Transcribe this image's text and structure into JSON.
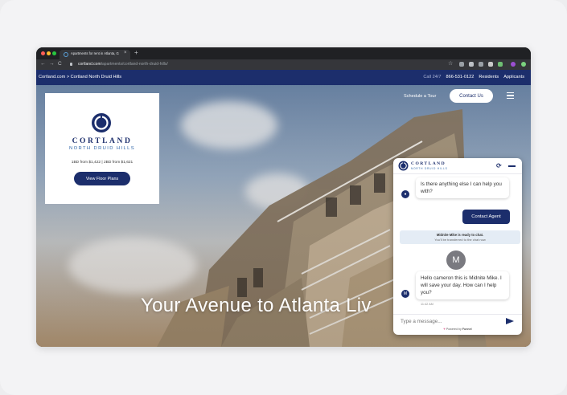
{
  "browser": {
    "tab_title": "Apartments for rent in Atlanta, G",
    "tab_close": "×",
    "new_tab": "+",
    "url_domain": "cortland.com",
    "url_path": "/apartments/cortland-north-druid-hills/",
    "back": "←",
    "forward": "→",
    "reload": "C"
  },
  "site_nav": {
    "breadcrumb": "Cortland.com  >  Cortland North Druid Hills",
    "call_label": "Call 24/7",
    "phone": "866-531-0122",
    "residents": "Residents",
    "applicants": "Applicants"
  },
  "hero": {
    "schedule_tour": "Schedule a Tour",
    "contact_us": "Contact Us",
    "tagline": "Your Avenue to Atlanta Liv"
  },
  "brand_card": {
    "name": "CORTLAND",
    "subname": "NORTH DRUID HILLS",
    "prices": "1BD from $1,422 | 2BD from $1,621",
    "cta": "View Floor Plans"
  },
  "chat": {
    "brand_name": "CORTLAND",
    "brand_sub": "NORTH DRUID HILLS",
    "bot_msg1": "Is there anything else I can help you with?",
    "contact_agent": "Contact Agent",
    "system_line1": "Midnite Mike is ready to chat.",
    "system_line2": "You'll be transferred to the chat now",
    "agent_initial": "M",
    "bot_initial": "M",
    "agent_msg": "Hello cameron this is Midnite Mike. I will save your day. How can I help you?",
    "timestamp": "11:42 AM",
    "input_placeholder": "Type a message...",
    "powered_by": "Powered by",
    "powered_brand": "Funnel"
  },
  "colors": {
    "brand_navy": "#1c2e6c",
    "brand_blue": "#2f66a8"
  }
}
